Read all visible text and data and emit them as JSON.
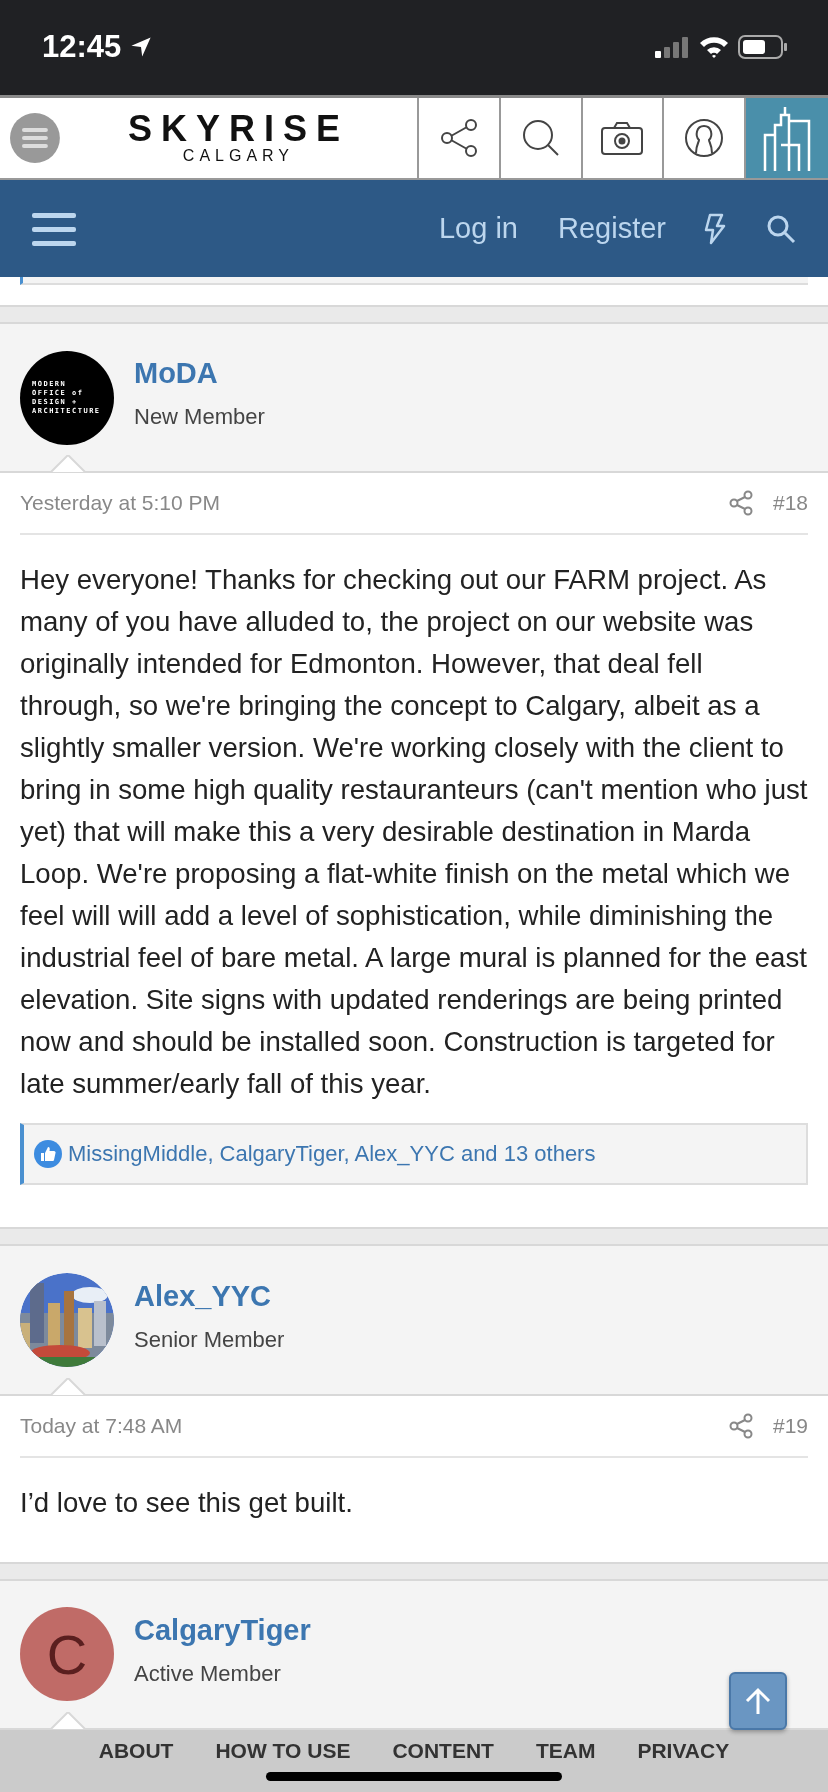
{
  "status_bar": {
    "time": "12:45"
  },
  "site_header": {
    "logo_title": "SKYRISE",
    "logo_subtitle": "CALGARY"
  },
  "nav": {
    "links": [
      "Log in",
      "Register"
    ]
  },
  "posts": [
    {
      "author": "MoDA",
      "role": "New Member",
      "avatar": {
        "kind": "logo",
        "lines": [
          "MODERN",
          "OFFICE of",
          "DESIGN +",
          "ARCHITECTURE"
        ]
      },
      "date": "Yesterday at 5:10 PM",
      "number": "#18",
      "body": "Hey everyone! Thanks for checking out our FARM project. As many of you have alluded to, the project on our website was originally intended for Edmonton. However, that deal fell through, so we're bringing the concept to Calgary, albeit as a slightly smaller version. We're working closely with the client to bring in some high quality restauranteurs (can't mention who just yet) that will make this a very desirable destination in Marda Loop. We're proposing a flat-white finish on the metal which we feel will will add a level of sophistication, while diminishing the industrial feel of bare metal. A large mural is planned for the east elevation. Site signs with updated renderings are being printed now and should be installed soon. Construction is targeted for late summer/early fall of this year.",
      "likes": "MissingMiddle, CalgaryTiger, Alex_YYC and 13 others"
    },
    {
      "author": "Alex_YYC",
      "role": "Senior Member",
      "date": "Today at 7:48 AM",
      "number": "#19",
      "body": "I’d love to see this get built."
    },
    {
      "author": "CalgaryTiger",
      "role": "Active Member",
      "avatar": {
        "kind": "letter",
        "letter": "C",
        "color": "#c06b67"
      }
    }
  ],
  "footer": {
    "links": [
      "ABOUT",
      "HOW TO USE",
      "CONTENT",
      "TEAM",
      "PRIVACY"
    ]
  }
}
